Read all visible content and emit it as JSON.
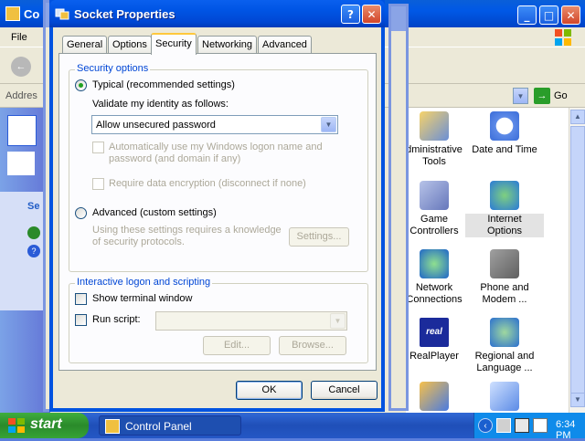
{
  "background_window": {
    "title": "Co",
    "menu_file": "File",
    "address_label": "Addres",
    "go_label": "Go",
    "left_pane_label": "Se"
  },
  "control_panel_items": [
    {
      "label": "dministrative\nTools",
      "icon": "administrative-tools-icon",
      "highlighted": false
    },
    {
      "label": "Date and Time",
      "icon": "date-time-icon",
      "highlighted": false
    },
    {
      "label": "Game\nControllers",
      "icon": "game-controllers-icon",
      "highlighted": false
    },
    {
      "label": "Internet\nOptions",
      "icon": "internet-options-icon",
      "highlighted": true
    },
    {
      "label": "Network\nConnections",
      "icon": "network-connections-icon",
      "highlighted": false
    },
    {
      "label": "Phone and\nModem ...",
      "icon": "phone-modem-icon",
      "highlighted": false
    },
    {
      "label": "RealPlayer",
      "icon": "realplayer-icon",
      "highlighted": false
    },
    {
      "label": "Regional and\nLanguage ...",
      "icon": "regional-language-icon",
      "highlighted": false
    }
  ],
  "dialog": {
    "title": "Socket Properties",
    "help_button": "?",
    "close_button": "✕",
    "tabs": [
      {
        "label": "General",
        "active": false
      },
      {
        "label": "Options",
        "active": false
      },
      {
        "label": "Security",
        "active": true
      },
      {
        "label": "Networking",
        "active": false
      },
      {
        "label": "Advanced",
        "active": false
      }
    ],
    "security_options": {
      "group_title": "Security options",
      "typical_label": "Typical (recommended settings)",
      "typical_selected": true,
      "validate_label": "Validate my identity as follows:",
      "validate_value": "Allow unsecured password",
      "auto_logon_label": "Automatically use my Windows logon name and password (and domain if any)",
      "require_encryption_label": "Require data encryption (disconnect if none)",
      "advanced_label": "Advanced (custom settings)",
      "advanced_selected": false,
      "advanced_note": "Using these settings requires a knowledge of security protocols.",
      "settings_button": "Settings..."
    },
    "interactive": {
      "group_title": "Interactive logon and scripting",
      "show_terminal_label": "Show terminal window",
      "run_script_label": "Run script:",
      "run_script_value": "",
      "edit_button": "Edit...",
      "browse_button": "Browse..."
    },
    "ok_button": "OK",
    "cancel_button": "Cancel"
  },
  "taskbar": {
    "start_label": "start",
    "task_label": "Control Panel",
    "clock": "6:34 PM"
  }
}
